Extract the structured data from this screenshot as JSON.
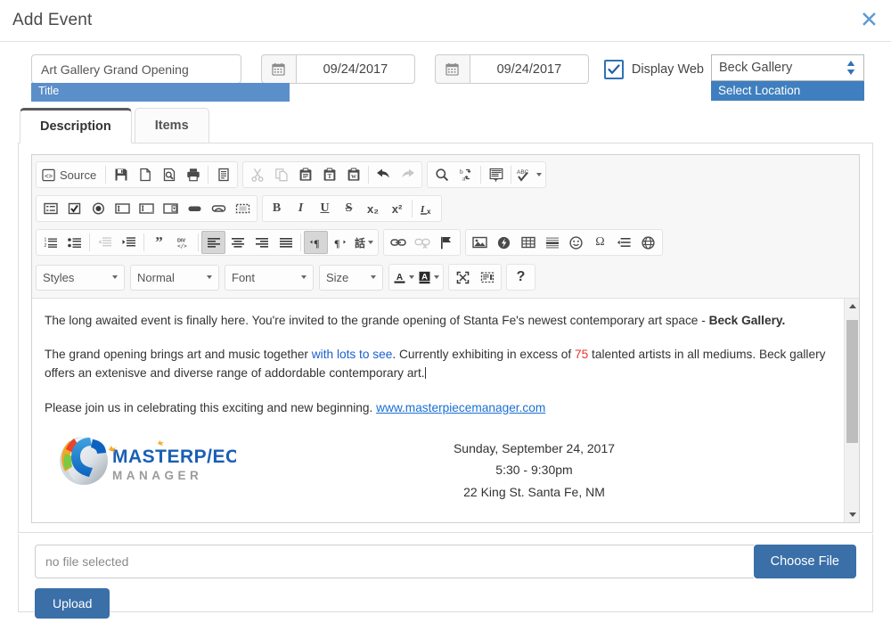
{
  "header": {
    "title": "Add Event",
    "close_icon": "close-x-icon"
  },
  "form": {
    "title_field": {
      "value": "Art Gallery Grand Opening",
      "label": "Title",
      "placeholder": "Title"
    },
    "start_date": {
      "value": "09/24/2017",
      "icon": "calendar-icon"
    },
    "end_date": {
      "value": "09/24/2017",
      "icon": "calendar-icon"
    },
    "display_web": {
      "label": "Display Web",
      "checked": true,
      "check_icon": "checkmark-icon"
    },
    "location_select": {
      "value": "Beck Gallery",
      "option": "Select Location",
      "spinner_icon": "spinner-up-down-icon"
    }
  },
  "tabs": [
    {
      "label": "Description",
      "active": true
    },
    {
      "label": "Items",
      "active": false
    }
  ],
  "editor": {
    "toolbar": {
      "row1_group1": [
        {
          "icon": "source-icon",
          "label": "Source"
        },
        {
          "icon": "save-icon",
          "label": ""
        },
        {
          "icon": "new-page-icon",
          "label": ""
        },
        {
          "icon": "preview-icon",
          "label": ""
        },
        {
          "icon": "print-icon",
          "label": ""
        },
        {
          "icon": "templates-icon",
          "label": ""
        }
      ],
      "row1_group2": [
        {
          "icon": "cut-icon"
        },
        {
          "icon": "copy-icon"
        },
        {
          "icon": "paste-icon"
        },
        {
          "icon": "paste-text-icon"
        },
        {
          "icon": "paste-word-icon"
        },
        {
          "icon": "undo-icon"
        },
        {
          "icon": "redo-icon"
        }
      ],
      "row1_group3": [
        {
          "icon": "find-icon"
        },
        {
          "icon": "replace-icon"
        },
        {
          "icon": "select-all-icon"
        },
        {
          "icon": "spellcheck-icon"
        }
      ],
      "row2_group1": [
        {
          "icon": "form-icon"
        },
        {
          "icon": "checkbox-icon"
        },
        {
          "icon": "radio-icon"
        },
        {
          "icon": "text-field-icon"
        },
        {
          "icon": "textarea-icon"
        },
        {
          "icon": "select-field-icon"
        },
        {
          "icon": "button-icon"
        },
        {
          "icon": "image-button-icon"
        },
        {
          "icon": "hidden-field-icon"
        }
      ],
      "row2_group2": [
        {
          "icon": "bold-icon",
          "label": "B"
        },
        {
          "icon": "italic-icon",
          "label": "I"
        },
        {
          "icon": "underline-icon",
          "label": "U"
        },
        {
          "icon": "strike-icon",
          "label": "S"
        },
        {
          "icon": "subscript-icon",
          "label": "x₂"
        },
        {
          "icon": "superscript-icon",
          "label": "x²"
        },
        {
          "icon": "remove-format-icon",
          "label": "Ix"
        }
      ],
      "row3_group1": [
        {
          "icon": "numbered-list-icon"
        },
        {
          "icon": "bulleted-list-icon"
        },
        {
          "icon": "outdent-icon"
        },
        {
          "icon": "indent-icon"
        },
        {
          "icon": "blockquote-icon"
        },
        {
          "icon": "div-container-icon"
        },
        {
          "icon": "align-left-icon",
          "active": true
        },
        {
          "icon": "align-center-icon"
        },
        {
          "icon": "align-right-icon"
        },
        {
          "icon": "justify-icon"
        },
        {
          "icon": "text-direction-ltr-icon",
          "active": true
        },
        {
          "icon": "text-direction-rtl-icon"
        },
        {
          "icon": "language-icon"
        }
      ],
      "row3_group2": [
        {
          "icon": "link-icon"
        },
        {
          "icon": "unlink-icon"
        },
        {
          "icon": "anchor-icon"
        }
      ],
      "row3_group3": [
        {
          "icon": "image-icon"
        },
        {
          "icon": "flash-icon"
        },
        {
          "icon": "table-icon"
        },
        {
          "icon": "horizontal-rule-icon"
        },
        {
          "icon": "smiley-icon"
        },
        {
          "icon": "special-char-icon"
        },
        {
          "icon": "page-break-icon"
        },
        {
          "icon": "iframe-icon"
        }
      ],
      "row4": {
        "styles": "Styles",
        "format": "Normal",
        "font": "Font",
        "size": "Size",
        "text_color_icon": "text-color-icon",
        "bg_color_icon": "background-color-icon",
        "maximize_icon": "maximize-icon",
        "show_blocks_icon": "show-blocks-icon",
        "help_icon": "help-icon"
      }
    },
    "content": {
      "p1_part1": "The long awaited event is finally here. You're invited to the grande opening of Stanta Fe's newest contemporary art space - ",
      "p1_bold": "Beck Gallery.",
      "p2_part1": "The grand opening brings art and music together ",
      "p2_link": "with lots to see",
      "p2_part2": ". Currently exhibiting in excess of ",
      "p2_number": "75",
      "p2_part3": " talented artists in all mediums. Beck gallery offers an extenisve and diverse range of addordable contemporary art.",
      "p3_part1": "Please join us in celebrating this exciting and new beginning. ",
      "p3_link": "www.masterpiecemanager.com",
      "logo_primary": "MASTERPIECE",
      "logo_secondary": "M A N A G E R",
      "flyer_date": "Sunday, September 24, 2017",
      "flyer_time": "5:30 - 9:30pm",
      "flyer_address": "22 King St. Santa Fe, NM"
    },
    "scrollbar": {
      "up_icon": "scroll-up-arrow-icon",
      "down_icon": "scroll-down-arrow-icon"
    }
  },
  "upload": {
    "file_placeholder": "no file selected",
    "choose_label": "Choose File",
    "upload_label": "Upload"
  },
  "colors": {
    "accent_blue": "#3a6fa8",
    "label_blue": "#5b8fc9",
    "link_blue": "#1a5fd0",
    "red": "#e8342a",
    "close_blue": "#5b9bd5"
  }
}
